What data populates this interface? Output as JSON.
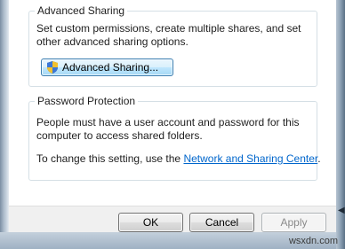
{
  "advanced_sharing": {
    "title": "Advanced Sharing",
    "description": "Set custom permissions, create multiple shares, and set other advanced sharing options.",
    "button_label": "Advanced Sharing..."
  },
  "password_protection": {
    "title": "Password Protection",
    "description": "People must have a user account and password for this computer to access shared folders.",
    "change_prefix": "To change this setting, use the ",
    "link_text": "Network and Sharing Center",
    "change_suffix": "."
  },
  "buttons": {
    "ok": "OK",
    "cancel": "Cancel",
    "apply": "Apply"
  },
  "watermark": "wsxdn.com",
  "icons": {
    "shield": "uac-shield-icon"
  }
}
